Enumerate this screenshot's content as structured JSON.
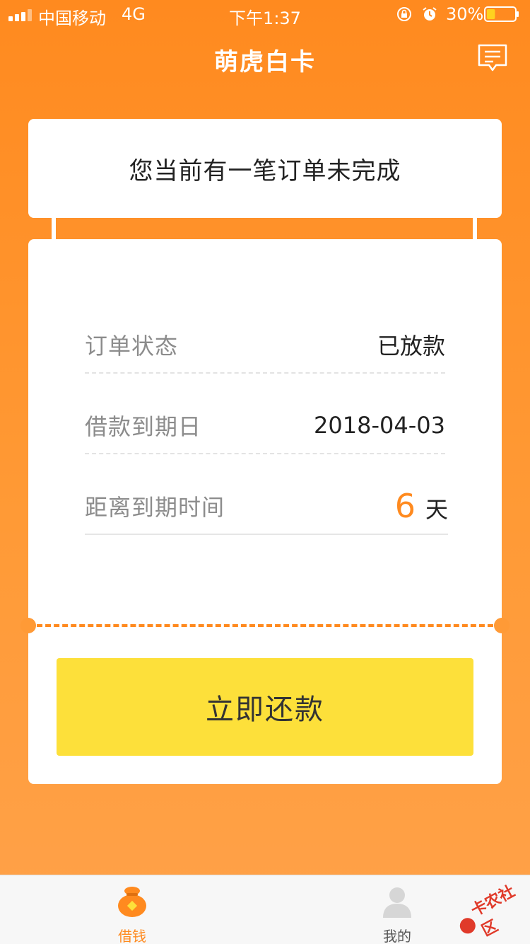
{
  "status_bar": {
    "carrier": "中国移动",
    "network": "4G",
    "time": "下午1:37",
    "battery_percent": "30%",
    "battery_level": 0.3
  },
  "header": {
    "title": "萌虎白卡",
    "message_icon": "message-icon"
  },
  "notice": {
    "text": "您当前有一笔订单未完成"
  },
  "order": {
    "status_label": "订单状态",
    "status_value": "已放款",
    "due_date_label": "借款到期日",
    "due_date_value": "2018-04-03",
    "remaining_label": "距离到期时间",
    "remaining_days": "6",
    "remaining_unit": "天"
  },
  "actions": {
    "repay_label": "立即还款"
  },
  "tabs": [
    {
      "label": "借钱",
      "icon": "money-bag-icon",
      "active": true
    },
    {
      "label": "我的",
      "icon": "user-icon",
      "active": false
    }
  ],
  "watermark": {
    "text": "卡农社区"
  },
  "colors": {
    "accent": "#ff8a1f",
    "button": "#fde03a"
  }
}
